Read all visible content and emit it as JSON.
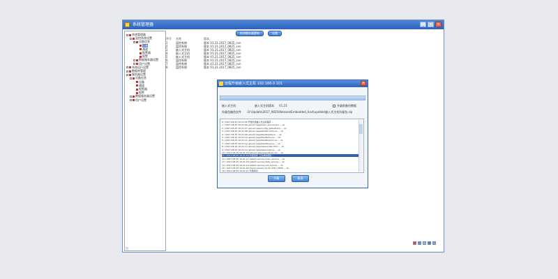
{
  "window": {
    "title": "系统管理器",
    "controls": {
      "minimize": "_",
      "maximize": "□",
      "close": "×"
    }
  },
  "tree": {
    "items": [
      {
        "label": "系统管理器",
        "indent": 0,
        "expander": "-",
        "icon_color": "#c83232"
      },
      {
        "label": "监控系统设置",
        "indent": 1,
        "expander": "-",
        "icon_color": "#c83232"
      },
      {
        "label": "设备信息",
        "indent": 2,
        "expander": "-",
        "icon_color": "#c83232"
      },
      {
        "label": "设备",
        "indent": 3,
        "expander": "",
        "icon_color": "#c83232",
        "selected": true
      },
      {
        "label": "通道",
        "indent": 3,
        "expander": "",
        "icon_color": "#c83232"
      },
      {
        "label": "报警器",
        "indent": 3,
        "expander": "",
        "icon_color": "#c83232"
      },
      {
        "label": "报警",
        "indent": 3,
        "expander": "",
        "icon_color": "#c83232"
      },
      {
        "label": "数据服务器设置",
        "indent": 2,
        "expander": "+",
        "icon_color": "#c83232"
      },
      {
        "label": "用户设置",
        "indent": 2,
        "expander": "+",
        "icon_color": "#c83232"
      },
      {
        "label": "系统运行设置",
        "indent": 0,
        "expander": "+",
        "icon_color": "#c83232"
      },
      {
        "label": "数据库管理",
        "indent": 0,
        "expander": "+",
        "icon_color": "#c83232"
      },
      {
        "label": "服务器设置",
        "indent": 0,
        "expander": "-",
        "icon_color": "#c83232"
      },
      {
        "label": "设备信息",
        "indent": 1,
        "expander": "-",
        "icon_color": "#c83232"
      },
      {
        "label": "设备",
        "indent": 2,
        "expander": "",
        "icon_color": "#c83232"
      },
      {
        "label": "通道",
        "indent": 2,
        "expander": "",
        "icon_color": "#c83232"
      },
      {
        "label": "报警器",
        "indent": 2,
        "expander": "",
        "icon_color": "#c83232"
      },
      {
        "label": "报警",
        "indent": 2,
        "expander": "",
        "icon_color": "#c83232"
      },
      {
        "label": "数据服务器设置",
        "indent": 1,
        "expander": "+",
        "icon_color": "#c83232"
      },
      {
        "label": "用户设置",
        "indent": 1,
        "expander": "+",
        "icon_color": "#c83232"
      }
    ]
  },
  "toolbar": {
    "check_update_label": "检测服务器更新",
    "settings_label": "设置"
  },
  "list": {
    "headers": [
      "序号",
      "名称",
      "版本"
    ],
    "rows": [
      {
        "n": "1",
        "name": "监控系统",
        "ver": "版本 V1.21.2017_0825_svn"
      },
      {
        "n": "2",
        "name": "监控系统",
        "ver": "版本 V1.21.2017_0825_svn"
      },
      {
        "n": "3",
        "name": "嵌入式主机",
        "ver": "版本 V1.21.2017_0825_svn"
      },
      {
        "n": "4",
        "name": "嵌入式主机",
        "ver": "版本 V1.21.2017_0825_svn"
      },
      {
        "n": "5",
        "name": "嵌入式主机",
        "ver": "版本 V1.21.2017_0825_svn"
      },
      {
        "n": "6",
        "name": "监控系统",
        "ver": "版本 V1.21.2017_0825_svn"
      },
      {
        "n": "7",
        "name": "监控系统",
        "ver": "版本 V1.21.2017_0825_svn"
      },
      {
        "n": "8",
        "name": "监控系统",
        "ver": "版本 V1.21.2017_0825_svn"
      }
    ]
  },
  "dialog": {
    "title": "远程升级嵌入式主机 192.168.0.101",
    "progress_fraction": 1.0,
    "field1_label": "嵌入式主机",
    "field2_label": "嵌入式主机版本",
    "field3_value": "V1.21",
    "checkbox_label": "升级前备份数据",
    "path_label": "升级包路径文件",
    "path_value": "D:\\Update\\2017_0825\\Release\\Embedded_host\\update\\嵌入式主机升级包.zip",
    "log_lines": [
      "0 / 2017-08-25 10:21:05  开始升级嵌入式主机程序 ...",
      "1 / 2017-08-25 10:21:06  upload /app/main_service.bin ... ok",
      "2 / 2017-08-25 10:21:07  upload /app/config_default.xml ... ok",
      "3 / 2017-08-25 10:21:08  upload /app/libs/libcomm.so ... ok",
      "4 / 2017-08-25 10:21:09  upload /app/libs/libdata.so ... ok",
      "5 / 2017-08-25 10:21:10  upload /app/libs/libdev.so ... ok",
      "6 / 2017-08-25 10:21:11  upload /app/libs/libalarm.so ... ok",
      "7 / 2017-08-25 10:21:12  upload /app/libs/libnet.so ... ok",
      "8 / 2017-08-25 10:21:13  upload /app/www/index.html ... ok",
      "9 / 2017-08-25 10:21:14  upload /app/www/main.js ... ok",
      "10 / 2017-08-25 10:21:15  upload /app/www/style.css ... ok",
      "11 / 2017-08-25 10:21:16  升级完成, 正在重启服务 ...",
      "12 / 2017-08-25 10:21:17  restart service main_service ... ok",
      "13 / 2017-08-25 10:21:18  restart service data_service ... ok",
      "14 / 2017-08-25 10:21:19  restart service net_service ... ok",
      "15 / 2017-08-25 10:21:20  check version V1.21.2017_0825 ... ok",
      "16 / 2017-08-25 10:21:21  升级成功"
    ],
    "selected_line": 11,
    "ok_label": "升级",
    "cancel_label": "取消"
  },
  "colors": {
    "accent": "#2b63bd",
    "tree_icon": "#c83232"
  }
}
